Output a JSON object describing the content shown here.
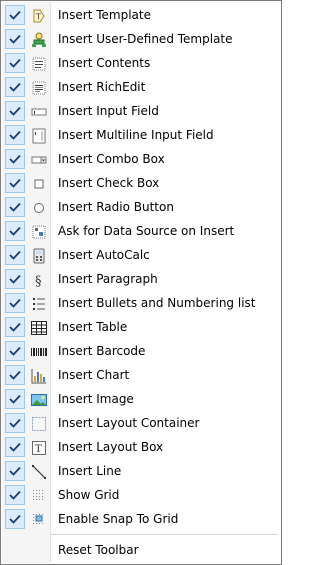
{
  "menu": {
    "items": [
      {
        "label": "Insert Template",
        "icon": "template-icon",
        "checked": true
      },
      {
        "label": "Insert User-Defined Template",
        "icon": "user-defined-template-icon",
        "checked": true
      },
      {
        "label": "Insert Contents",
        "icon": "contents-icon",
        "checked": true
      },
      {
        "label": "Insert RichEdit",
        "icon": "richedit-icon",
        "checked": true
      },
      {
        "label": "Insert Input Field",
        "icon": "input-field-icon",
        "checked": true
      },
      {
        "label": "Insert Multiline Input Field",
        "icon": "multiline-input-field-icon",
        "checked": true
      },
      {
        "label": "Insert Combo Box",
        "icon": "combo-box-icon",
        "checked": true
      },
      {
        "label": "Insert Check Box",
        "icon": "check-box-icon",
        "checked": true
      },
      {
        "label": "Insert Radio Button",
        "icon": "radio-button-icon",
        "checked": true
      },
      {
        "label": "Ask for Data Source on Insert",
        "icon": "data-source-icon",
        "checked": true
      },
      {
        "label": "Insert AutoCalc",
        "icon": "autocalc-icon",
        "checked": true
      },
      {
        "label": "Insert Paragraph",
        "icon": "paragraph-icon",
        "checked": true
      },
      {
        "label": "Insert Bullets and Numbering list",
        "icon": "bullets-numbering-icon",
        "checked": true
      },
      {
        "label": "Insert Table",
        "icon": "table-icon",
        "checked": true
      },
      {
        "label": "Insert Barcode",
        "icon": "barcode-icon",
        "checked": true
      },
      {
        "label": "Insert Chart",
        "icon": "chart-icon",
        "checked": true
      },
      {
        "label": "Insert Image",
        "icon": "image-icon",
        "checked": true
      },
      {
        "label": "Insert Layout Container",
        "icon": "layout-container-icon",
        "checked": true
      },
      {
        "label": "Insert Layout Box",
        "icon": "layout-box-icon",
        "checked": true
      },
      {
        "label": "Insert Line",
        "icon": "line-icon",
        "checked": true
      },
      {
        "label": "Show Grid",
        "icon": "grid-icon",
        "checked": true
      },
      {
        "label": "Enable Snap To Grid",
        "icon": "snap-grid-icon",
        "checked": true
      }
    ],
    "reset_label": "Reset Toolbar"
  },
  "colors": {
    "check_bg": "#dcecfc",
    "check_border": "#99c9ef",
    "check_mark": "#1b3a6b"
  }
}
